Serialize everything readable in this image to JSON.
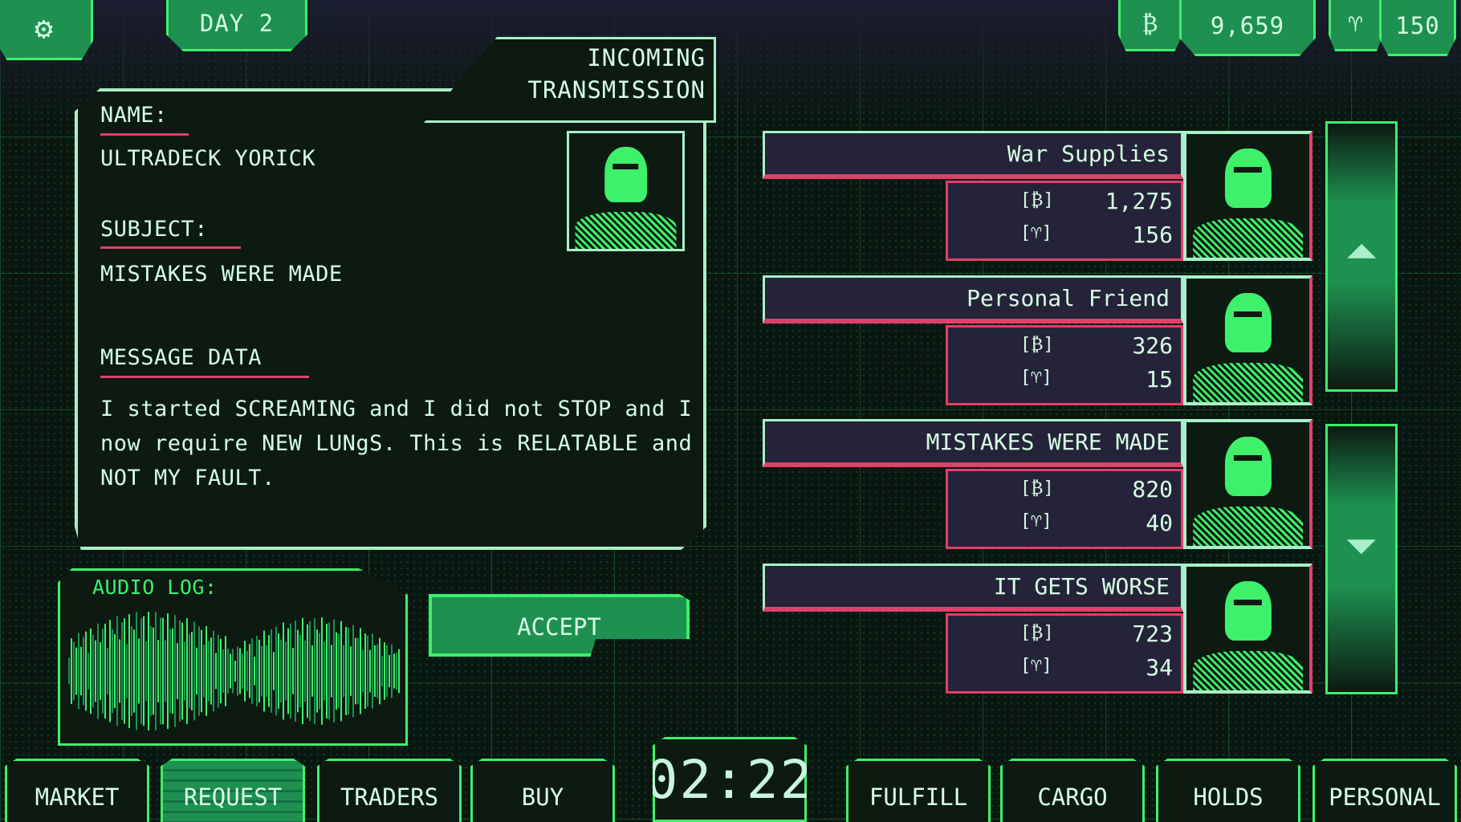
{
  "hud": {
    "day": "DAY 2",
    "credits": "9,659",
    "reputation": "150",
    "credit_icon": "credit-glyph",
    "reputation_icon": "trophy-icon",
    "settings_icon": "gear-icon"
  },
  "transmission": {
    "header_line1": "INCOMING",
    "header_line2": "TRANSMISSION",
    "name_label": "NAME:",
    "name": "ULTRADECK YORICK",
    "subject_label": "SUBJECT:",
    "subject": "MISTAKES WERE MADE",
    "message_label": "MESSAGE DATA",
    "message_lines": [
      "I started SCREAMING and I did not STOP and I",
      "now require NEW LUNgS. This is RELATABLE and",
      "NOT MY FAULT."
    ]
  },
  "audio": {
    "label": "AUDIO LOG:"
  },
  "accept_label": "ACCEPT",
  "requests": [
    {
      "title": "War Supplies",
      "credits": "1,275",
      "reputation": "156"
    },
    {
      "title": "Personal Friend",
      "credits": "326",
      "reputation": "15"
    },
    {
      "title": "MISTAKES WERE MADE",
      "credits": "820",
      "reputation": "40"
    },
    {
      "title": "IT GETS WORSE",
      "credits": "723",
      "reputation": "34"
    }
  ],
  "icons": {
    "credit": "⟦₿⟧",
    "trophy": "[🏆]"
  },
  "timer": "02:22",
  "tabs": [
    "MARKET",
    "REQUEST",
    "TRADERS",
    "BUY",
    "FULFILL",
    "CARGO",
    "HOLDS",
    "PERSONAL"
  ],
  "active_tab": "REQUEST",
  "colors": {
    "bright_green": "#3ef06a",
    "mid_green": "#1e9150",
    "pale": "#a8f0c8",
    "pink": "#e0406a",
    "card": "#25233a",
    "bg": "#0a1711"
  }
}
